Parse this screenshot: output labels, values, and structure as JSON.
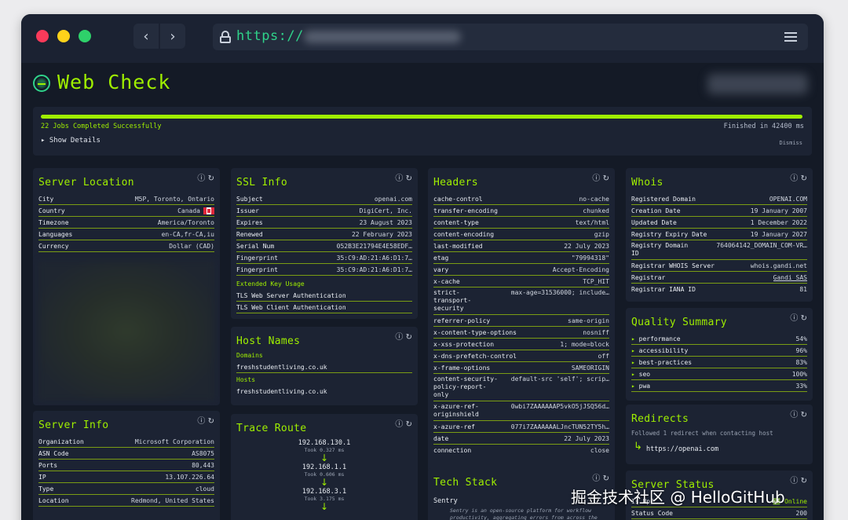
{
  "browser": {
    "url_prefix": "https://",
    "back_icon": "‹",
    "forward_icon": "›"
  },
  "app": {
    "title": "Web Check"
  },
  "progress": {
    "jobs": "22 Jobs Completed Successfully",
    "finished": "Finished in 42400 ms",
    "show_details": "▸ Show Details",
    "dismiss": "Dismiss",
    "fraction": 1.0
  },
  "icons": {
    "info": "ⓘ",
    "refresh": "↻"
  },
  "server_location": {
    "title": "Server Location",
    "rows": [
      {
        "k": "City",
        "v": "M5P, Toronto, Ontario"
      },
      {
        "k": "Country",
        "v": "Canada"
      },
      {
        "k": "Timezone",
        "v": "America/Toronto"
      },
      {
        "k": "Languages",
        "v": "en-CA,fr-CA,iu"
      },
      {
        "k": "Currency",
        "v": "Dollar (CAD)"
      }
    ]
  },
  "server_info": {
    "title": "Server Info",
    "rows": [
      {
        "k": "Organization",
        "v": "Microsoft Corporation"
      },
      {
        "k": "ASN Code",
        "v": "AS8075"
      },
      {
        "k": "Ports",
        "v": "80,443"
      },
      {
        "k": "IP",
        "v": "13.107.226.64"
      },
      {
        "k": "Type",
        "v": "cloud"
      },
      {
        "k": "Location",
        "v": "Redmond, United States"
      }
    ]
  },
  "ssl": {
    "title": "SSL Info",
    "rows": [
      {
        "k": "Subject",
        "v": "openai.com"
      },
      {
        "k": "Issuer",
        "v": "DigiCert, Inc."
      },
      {
        "k": "Expires",
        "v": "23 August 2023"
      },
      {
        "k": "Renewed",
        "v": "22 February 2023"
      },
      {
        "k": "Serial Num",
        "v": "052B3E21794E4E58EDF…"
      },
      {
        "k": "Fingerprint",
        "v": "35:C9:AD:21:A6:D1:7…"
      },
      {
        "k": "Fingerprint",
        "v": "35:C9:AD:21:A6:D1:7…"
      }
    ],
    "eku_label": "Extended Key Usage",
    "eku": [
      "TLS Web Server Authentication",
      "TLS Web Client Authentication"
    ]
  },
  "hosts": {
    "title": "Host Names",
    "domains_label": "Domains",
    "domain": "freshstudentliving.co.uk",
    "hosts_label": "Hosts",
    "host": "freshstudentliving.co.uk"
  },
  "trace": {
    "title": "Trace Route",
    "hops": [
      {
        "ip": "192.168.130.1",
        "took": "Took 0.327 ms"
      },
      {
        "ip": "192.168.1.1",
        "took": "Took 0.606 ms"
      },
      {
        "ip": "192.168.3.1",
        "took": "Took 3.175 ms"
      }
    ],
    "arrow": "↓"
  },
  "headers": {
    "title": "Headers",
    "rows": [
      {
        "k": "cache-control",
        "v": "no-cache"
      },
      {
        "k": "transfer-encoding",
        "v": "chunked"
      },
      {
        "k": "content-type",
        "v": "text/html"
      },
      {
        "k": "content-encoding",
        "v": "gzip"
      },
      {
        "k": "last-modified",
        "v": "22 July 2023"
      },
      {
        "k": "etag",
        "v": "\"79994318\""
      },
      {
        "k": "vary",
        "v": "Accept-Encoding"
      },
      {
        "k": "x-cache",
        "v": "TCP_HIT"
      },
      {
        "k": "strict-transport-security",
        "v": "max-age=31536000; include…"
      },
      {
        "k": "referrer-policy",
        "v": "same-origin"
      },
      {
        "k": "x-content-type-options",
        "v": "nosniff"
      },
      {
        "k": "x-xss-protection",
        "v": "1; mode=block"
      },
      {
        "k": "x-dns-prefetch-control",
        "v": "off"
      },
      {
        "k": "x-frame-options",
        "v": "SAMEORIGIN"
      },
      {
        "k": "content-security-policy-report-only",
        "v": "default-src 'self'; scrip…"
      },
      {
        "k": "x-azure-ref-originshield",
        "v": "0wbi7ZAAAAAAP5vkO5jJSQ56d…"
      },
      {
        "k": "x-azure-ref",
        "v": "077i7ZAAAAAALJncTUN52TY5h…"
      },
      {
        "k": "date",
        "v": "22 July 2023"
      },
      {
        "k": "connection",
        "v": "close"
      }
    ]
  },
  "tech": {
    "title": "Tech Stack",
    "name": "Sentry",
    "desc": "Sentry is an open-source platform for workflow productivity, aggregating errors from across the"
  },
  "whois": {
    "title": "Whois",
    "rows": [
      {
        "k": "Registered Domain",
        "v": "OPENAI.COM"
      },
      {
        "k": "Creation Date",
        "v": "19 January 2007"
      },
      {
        "k": "Updated Date",
        "v": "1 December 2022"
      },
      {
        "k": "Registry Expiry Date",
        "v": "19 January 2027"
      },
      {
        "k": "Registry Domain ID",
        "v": "764064142_DOMAIN_COM-VR…"
      },
      {
        "k": "Registrar WHOIS Server",
        "v": "whois.gandi.net"
      },
      {
        "k": "Registrar",
        "v": "Gandi SAS"
      },
      {
        "k": "Registrar IANA ID",
        "v": "81"
      }
    ]
  },
  "quality": {
    "title": "Quality Summary",
    "rows": [
      {
        "k": "performance",
        "v": "54%"
      },
      {
        "k": "accessibility",
        "v": "96%"
      },
      {
        "k": "best-practices",
        "v": "83%"
      },
      {
        "k": "seo",
        "v": "100%"
      },
      {
        "k": "pwa",
        "v": "33%"
      }
    ]
  },
  "redirects": {
    "title": "Redirects",
    "note": "Followed 1 redirect when contacting host",
    "arrow": "↳",
    "target": "https://openai.com"
  },
  "status": {
    "title": "Server Status",
    "rows": [
      {
        "k": "Is Up?",
        "v": "✅ Online"
      },
      {
        "k": "Status Code",
        "v": "200"
      }
    ]
  },
  "watermark": "掘金技术社区 @ HelloGitHub",
  "colors": {
    "accent": "#9fef00",
    "background": "#141a26",
    "card": "#1c2333",
    "url": "#2fd38a"
  }
}
